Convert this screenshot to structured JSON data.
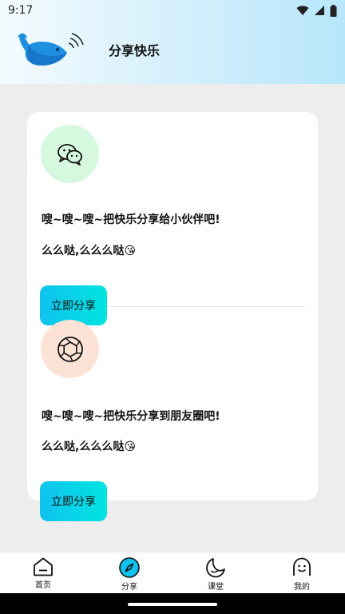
{
  "status_bar": {
    "time": "9:17",
    "icons": [
      "wifi-icon",
      "signal-icon",
      "battery-icon"
    ]
  },
  "header": {
    "title": "分享快乐",
    "logo": "whale-logo"
  },
  "share_items": [
    {
      "icon": "wechat-icon",
      "line1": "嗖~嗖~嗖~把快乐分享给小伙伴吧!",
      "line2": "么么哒,么么么哒😘",
      "button": "立即分享"
    },
    {
      "icon": "camera-aperture-icon",
      "line1": "嗖~嗖~嗖~把快乐分享到朋友圈吧!",
      "line2": "么么哒,么么么哒😘",
      "button": "立即分享"
    }
  ],
  "nav": [
    {
      "label": "首页",
      "icon": "home-icon"
    },
    {
      "label": "分享",
      "icon": "compass-icon",
      "active": true
    },
    {
      "label": "课堂",
      "icon": "moon-icon"
    },
    {
      "label": "我的",
      "icon": "profile-icon"
    }
  ],
  "colors": {
    "accent": "#10c2ee",
    "button_end": "#00e4e0",
    "wechat_bg": "#d6f8df",
    "moments_bg": "#fde3d6"
  }
}
